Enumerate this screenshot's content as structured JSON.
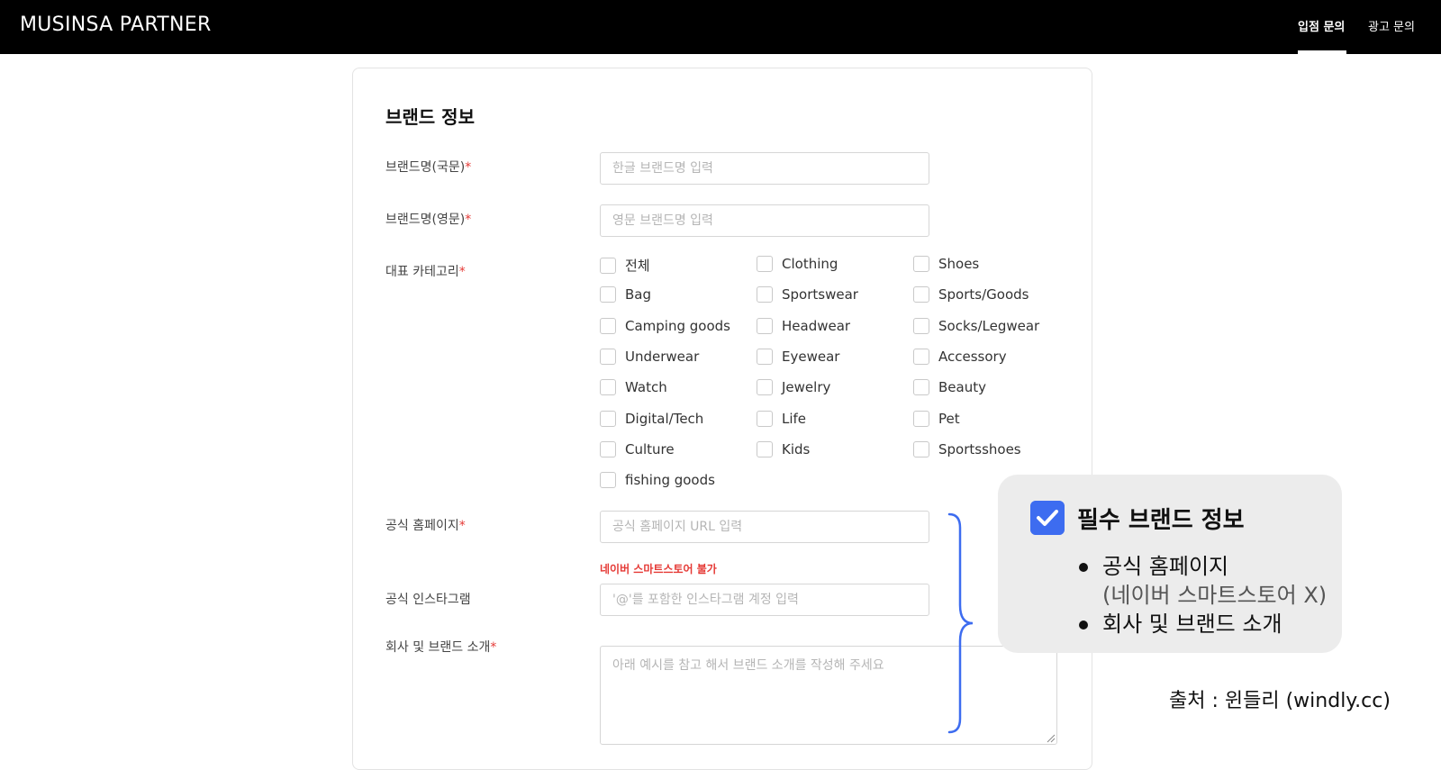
{
  "topbar": {
    "logo": "MUSINSA PARTNER",
    "nav": [
      {
        "label": "입점 문의",
        "active": true
      },
      {
        "label": "광고 문의",
        "active": false
      }
    ]
  },
  "form": {
    "section_title": "브랜드 정보",
    "required_mark": "*",
    "fields": {
      "brand_name_kr": {
        "label": "브랜드명(국문)",
        "placeholder": "한글 브랜드명 입력",
        "value": ""
      },
      "brand_name_en": {
        "label": "브랜드명(영문)",
        "placeholder": "영문 브랜드명 입력",
        "value": ""
      },
      "category": {
        "label": "대표 카테고리"
      },
      "homepage": {
        "label": "공식 홈페이지",
        "placeholder": "공식 홈페이지 URL 입력",
        "value": "",
        "warning": "네이버 스마트스토어 불가"
      },
      "instagram": {
        "label": "공식 인스타그램",
        "placeholder": "'@'를 포함한 인스타그램 계정 입력",
        "value": ""
      },
      "intro": {
        "label": "회사 및 브랜드 소개",
        "placeholder": "아래 예시를 참고 해서 브랜드 소개를 작성해 주세요",
        "value": ""
      }
    },
    "categories": [
      {
        "label": "전체",
        "checked": false
      },
      {
        "label": "Clothing",
        "checked": false
      },
      {
        "label": "Shoes",
        "checked": false
      },
      {
        "label": "Bag",
        "checked": false
      },
      {
        "label": "Sportswear",
        "checked": false
      },
      {
        "label": "Sports/Goods",
        "checked": false
      },
      {
        "label": "Camping goods",
        "checked": false
      },
      {
        "label": "Headwear",
        "checked": false
      },
      {
        "label": "Socks/Legwear",
        "checked": false
      },
      {
        "label": "Underwear",
        "checked": false
      },
      {
        "label": "Eyewear",
        "checked": false
      },
      {
        "label": "Accessory",
        "checked": false
      },
      {
        "label": "Watch",
        "checked": false
      },
      {
        "label": "Jewelry",
        "checked": false
      },
      {
        "label": "Beauty",
        "checked": false
      },
      {
        "label": "Digital/Tech",
        "checked": false
      },
      {
        "label": "Life",
        "checked": false
      },
      {
        "label": "Pet",
        "checked": false
      },
      {
        "label": "Culture",
        "checked": false
      },
      {
        "label": "Kids",
        "checked": false
      },
      {
        "label": "Sportsshoes",
        "checked": false
      },
      {
        "label": "fishing goods",
        "checked": false
      }
    ]
  },
  "callout": {
    "title": "필수 브랜드 정보",
    "items": [
      {
        "text": "공식 홈페이지",
        "note": "(네이버 스마트스토어 X)"
      },
      {
        "text": "회사 및 브랜드 소개",
        "note": ""
      }
    ]
  },
  "source_credit": "출처 : 윈들리 (windly.cc)",
  "colors": {
    "topbar_bg": "#000000",
    "required": "#e53935",
    "accent_blue": "#3d6cf0",
    "callout_bg": "#ececec"
  }
}
